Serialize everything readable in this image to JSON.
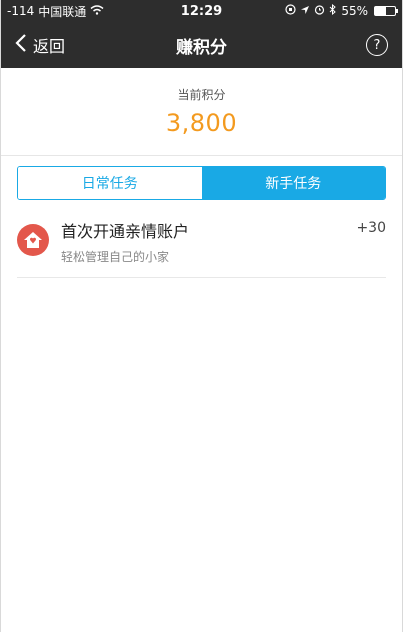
{
  "status_bar": {
    "signal": "-114",
    "carrier": "中国联通",
    "time": "12:29",
    "battery_percent": "55%",
    "battery_level": 0.55
  },
  "nav": {
    "back_label": "返回",
    "title": "赚积分",
    "help_glyph": "?"
  },
  "points": {
    "label": "当前积分",
    "value": "3,800"
  },
  "tabs": [
    {
      "label": "日常任务",
      "active": false
    },
    {
      "label": "新手任务",
      "active": true
    }
  ],
  "tasks": [
    {
      "title": "首次开通亲情账户",
      "subtitle": "轻松管理自己的小家",
      "reward": "+30",
      "icon": "home-icon"
    }
  ],
  "colors": {
    "accent_blue": "#19a9e5",
    "points_orange": "#f39a1f",
    "icon_red": "#e3574b",
    "header_dark": "#2d2d2d"
  }
}
